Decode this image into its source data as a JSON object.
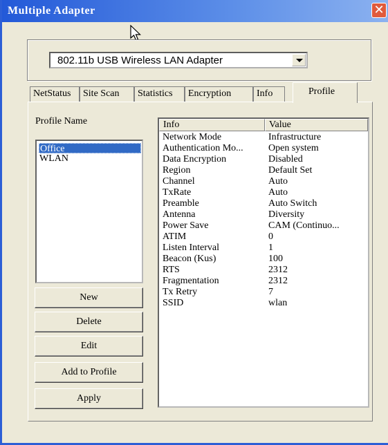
{
  "window": {
    "title": "Multiple Adapter",
    "close_glyph": "✕"
  },
  "adapter": {
    "selected": "802.11b USB Wireless LAN Adapter"
  },
  "tabs": [
    {
      "label": "NetStatus"
    },
    {
      "label": "Site Scan"
    },
    {
      "label": "Statistics"
    },
    {
      "label": "Encryption"
    },
    {
      "label": "Info"
    },
    {
      "label": "Profile"
    }
  ],
  "active_tab": "Profile",
  "profile": {
    "list_label": "Profile Name",
    "items": [
      "Office",
      "WLAN"
    ],
    "selected": "Office",
    "buttons": {
      "new": "New",
      "delete": "Delete",
      "edit": "Edit",
      "add_to_profile": "Add to Profile",
      "apply": "Apply"
    }
  },
  "info_table": {
    "headers": {
      "info": "Info",
      "value": "Value"
    },
    "rows": [
      {
        "info": "Network Mode",
        "value": "Infrastructure"
      },
      {
        "info": "Authentication Mo...",
        "value": "Open system"
      },
      {
        "info": "Data Encryption",
        "value": "Disabled"
      },
      {
        "info": "Region",
        "value": "Default Set"
      },
      {
        "info": "Channel",
        "value": "Auto"
      },
      {
        "info": "TxRate",
        "value": "Auto"
      },
      {
        "info": "Preamble",
        "value": "Auto Switch"
      },
      {
        "info": "Antenna",
        "value": "Diversity"
      },
      {
        "info": "Power Save",
        "value": "CAM (Continuo..."
      },
      {
        "info": "ATIM",
        "value": "0"
      },
      {
        "info": "Listen Interval",
        "value": "1"
      },
      {
        "info": "Beacon (Kus)",
        "value": "100"
      },
      {
        "info": "RTS",
        "value": "2312"
      },
      {
        "info": "Fragmentation",
        "value": "2312"
      },
      {
        "info": "Tx Retry",
        "value": "7"
      },
      {
        "info": "SSID",
        "value": "wlan"
      }
    ]
  },
  "colors": {
    "titlebar": "#2359d8",
    "selection": "#316ac5",
    "face": "#ece9d8"
  }
}
